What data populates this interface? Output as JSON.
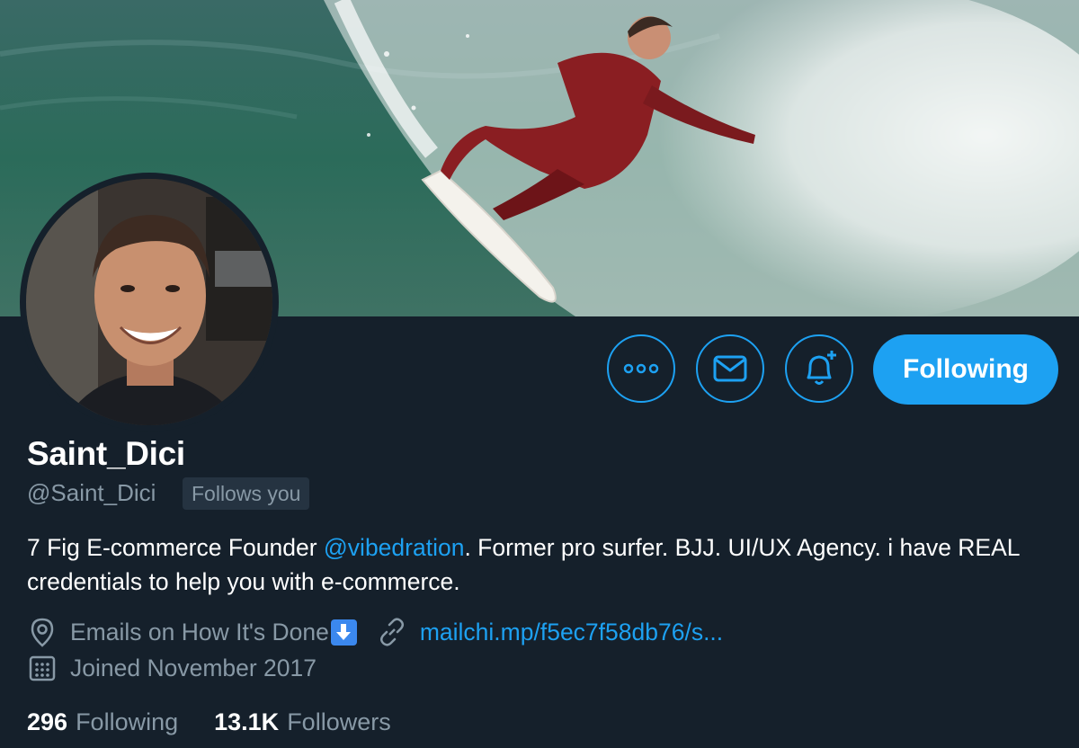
{
  "profile": {
    "name": "Saint_Dici",
    "handle": "@Saint_Dici",
    "follows_you_badge": "Follows you",
    "bio": {
      "before_mention": "7 Fig E-commerce Founder ",
      "mention": "@vibedration",
      "after_mention": ". Former pro surfer. BJJ. UI/UX Agency. i have REAL credentials to help you with e-commerce."
    },
    "location": "Emails on How It's Done",
    "location_emoji": "down-arrow-emoji",
    "website": "mailchi.mp/f5ec7f58db76/s...",
    "joined": "Joined November 2017",
    "following_count": "296",
    "following_label": "Following",
    "followers_count": "13.1K",
    "followers_label": "Followers"
  },
  "actions": {
    "more_icon": "more-dots-icon",
    "message_icon": "envelope-icon",
    "notify_icon": "bell-plus-icon",
    "follow_label": "Following"
  },
  "colors": {
    "background": "#15202b",
    "accent": "#1da1f2",
    "secondary_text": "#8899a6",
    "badge_bg": "#253341"
  }
}
